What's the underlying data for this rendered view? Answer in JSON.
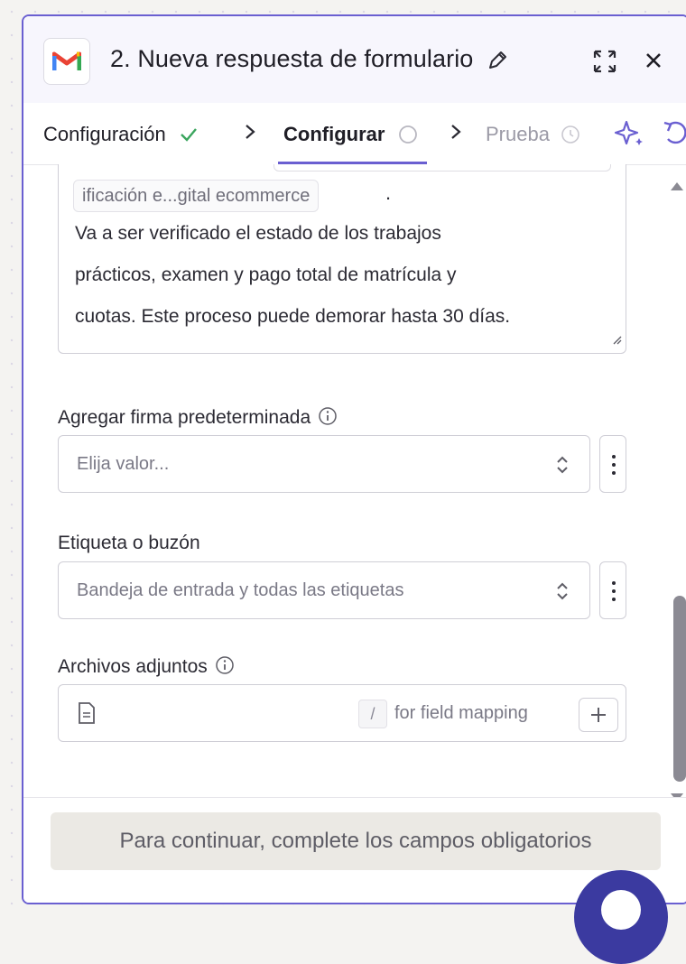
{
  "header": {
    "title": "2. Nueva respuesta de formulario",
    "app_icon": "gmail-logo",
    "actions": [
      "pencil-icon",
      "expand-icon",
      "close-icon"
    ]
  },
  "tabs": [
    {
      "label": "Configuración",
      "status": "check-icon"
    },
    {
      "label": "Configurar",
      "status": "circle-icon"
    },
    {
      "label": "Prueba",
      "status": "clock-icon"
    }
  ],
  "toolbar_icons": [
    "sparkle-icon",
    "undo-icon"
  ],
  "message": {
    "pill_text": "ificación e...gital ecommerce",
    "pill_suffix": ".",
    "lines": [
      "Va a ser verificado el estado de los trabajos",
      "prácticos, examen y pago total de matrícula y",
      "cuotas. Este proceso puede demorar hasta 30 días."
    ]
  },
  "fields": {
    "signature": {
      "label": "Agregar firma predeterminada",
      "placeholder": "Elija valor..."
    },
    "label_mailbox": {
      "label": "Etiqueta o buzón",
      "value": "Bandeja de entrada y todas las etiquetas"
    },
    "attachments": {
      "label": "Archivos adjuntos",
      "slash_key": "/",
      "hint": "for field mapping"
    }
  },
  "footer": {
    "continue_label": "Para continuar, complete los campos obligatorios"
  },
  "colors": {
    "accent": "#6a5fd1",
    "check": "#3aa55d",
    "gmail_red": "#ea4335"
  }
}
